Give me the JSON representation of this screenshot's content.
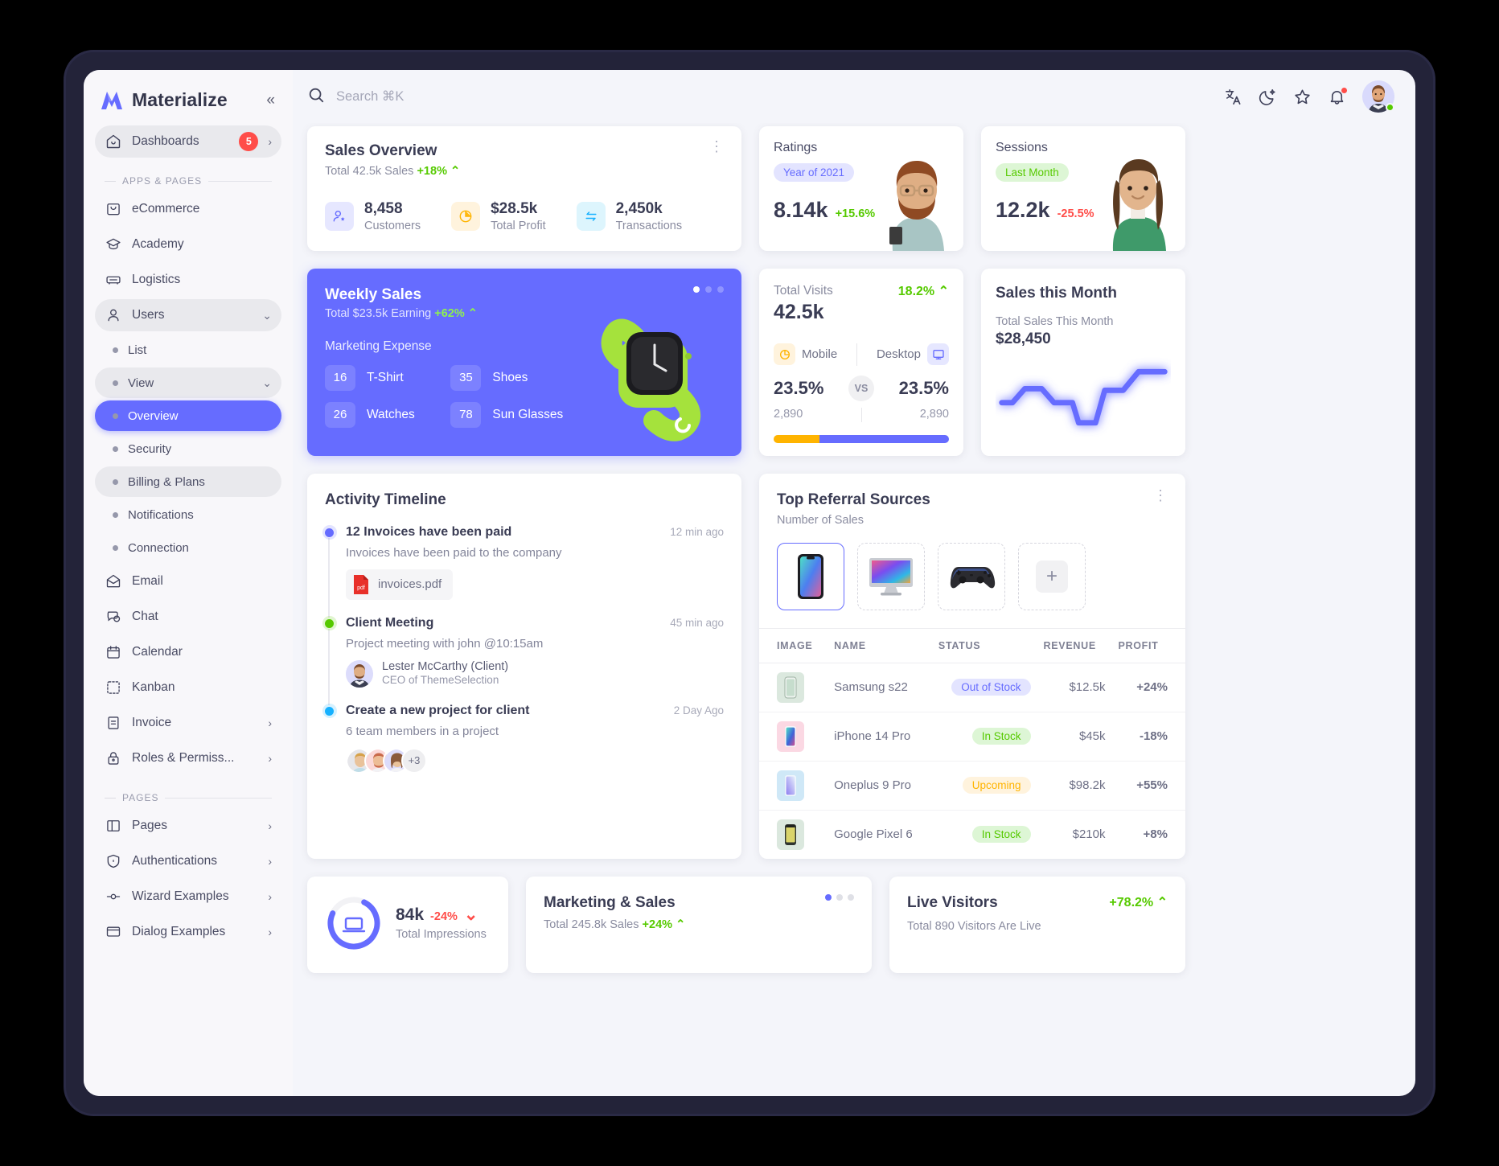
{
  "brand": {
    "name": "Materialize",
    "collapse_icon": "chevrons-left-icon"
  },
  "sidebar": {
    "dashboards": {
      "label": "Dashboards",
      "badge": "5"
    },
    "section_apps": "APPS & PAGES",
    "section_pages": "PAGES",
    "apps_items": [
      {
        "label": "eCommerce",
        "icon": "shopping-bag-icon"
      },
      {
        "label": "Academy",
        "icon": "graduation-cap-icon"
      },
      {
        "label": "Logistics",
        "icon": "car-icon"
      },
      {
        "label": "Users",
        "icon": "user-icon"
      }
    ],
    "users_children": [
      {
        "label": "List"
      },
      {
        "label": "View"
      }
    ],
    "view_children": [
      {
        "label": "Overview"
      },
      {
        "label": "Security"
      },
      {
        "label": "Billing & Plans"
      },
      {
        "label": "Notifications"
      },
      {
        "label": "Connection"
      }
    ],
    "apps_items2": [
      {
        "label": "Email",
        "icon": "mail-icon"
      },
      {
        "label": "Chat",
        "icon": "chat-icon"
      },
      {
        "label": "Calendar",
        "icon": "calendar-icon"
      },
      {
        "label": "Kanban",
        "icon": "kanban-icon"
      },
      {
        "label": "Invoice",
        "icon": "invoice-icon"
      },
      {
        "label": "Roles & Permiss...",
        "icon": "lock-icon"
      }
    ],
    "pages_items": [
      {
        "label": "Pages",
        "icon": "layout-icon"
      },
      {
        "label": "Authentications",
        "icon": "shield-icon"
      },
      {
        "label": "Wizard Examples",
        "icon": "wizard-icon"
      },
      {
        "label": "Dialog Examples",
        "icon": "dialog-icon"
      }
    ]
  },
  "topbar": {
    "search_placeholder": "Search ⌘K",
    "icons": [
      "translate-icon",
      "moon-icon",
      "star-icon",
      "bell-icon"
    ]
  },
  "sales_overview": {
    "title": "Sales Overview",
    "subtitle": "Total 42.5k Sales",
    "delta": "+18%",
    "stats": [
      {
        "value": "8,458",
        "label": "Customers",
        "icon": "customer-icon"
      },
      {
        "value": "$28.5k",
        "label": "Total Profit",
        "icon": "pie-icon"
      },
      {
        "value": "2,450k",
        "label": "Transactions",
        "icon": "transfer-icon"
      }
    ]
  },
  "ratings": {
    "title": "Ratings",
    "pill": "Year of 2021",
    "value": "8.14k",
    "delta": "+15.6%"
  },
  "sessions": {
    "title": "Sessions",
    "pill": "Last Month",
    "value": "12.2k",
    "delta": "-25.5%"
  },
  "weekly_sales": {
    "title": "Weekly Sales",
    "subtitle": "Total $23.5k Earning",
    "delta": "+62%",
    "section": "Marketing Expense",
    "items": [
      {
        "count": "16",
        "label": "T-Shirt"
      },
      {
        "count": "35",
        "label": "Shoes"
      },
      {
        "count": "26",
        "label": "Watches"
      },
      {
        "count": "78",
        "label": "Sun Glasses"
      }
    ]
  },
  "total_visits": {
    "label": "Total Visits",
    "delta": "18.2%",
    "value": "42.5k",
    "left": {
      "name": "Mobile",
      "pct": "23.5%",
      "count": "2,890",
      "icon": "pie-icon"
    },
    "right": {
      "name": "Desktop",
      "pct": "23.5%",
      "count": "2,890",
      "icon": "monitor-icon"
    },
    "vs": "VS",
    "bar_left_pct": 26
  },
  "sales_month": {
    "title": "Sales this Month",
    "subtitle": "Total Sales This Month",
    "value": "$28,450"
  },
  "timeline": {
    "title": "Activity Timeline",
    "items": [
      {
        "title": "12 Invoices have been paid",
        "time": "12 min ago",
        "desc": "Invoices have been paid to the company",
        "color": "#666cff",
        "file": "invoices.pdf"
      },
      {
        "title": "Client Meeting",
        "time": "45 min ago",
        "desc": "Project meeting with john @10:15am",
        "color": "#56ca00",
        "person_name": "Lester McCarthy (Client)",
        "person_role": "CEO of ThemeSelection"
      },
      {
        "title": "Create a new project for client",
        "time": "2 Day Ago",
        "desc": "6 team members in a project",
        "color": "#16b1ff",
        "more": "+3"
      }
    ]
  },
  "referral": {
    "title": "Top Referral Sources",
    "subtitle": "Number of Sales",
    "tiles": [
      "phone-icon",
      "imac-icon",
      "gamepad-icon",
      "add-icon"
    ],
    "columns": [
      "IMAGE",
      "NAME",
      "STATUS",
      "REVENUE",
      "PROFIT"
    ],
    "rows": [
      {
        "name": "Samsung s22",
        "status": "Out of Stock",
        "status_kind": "purple",
        "revenue": "$12.5k",
        "profit": "+24%",
        "profit_up": true,
        "bg": "#dbe8de"
      },
      {
        "name": "iPhone 14 Pro",
        "status": "In Stock",
        "status_kind": "green",
        "revenue": "$45k",
        "profit": "-18%",
        "profit_up": false,
        "bg": "#fbd8e3"
      },
      {
        "name": "Oneplus 9 Pro",
        "status": "Upcoming",
        "status_kind": "amber",
        "revenue": "$98.2k",
        "profit": "+55%",
        "profit_up": true,
        "bg": "#cfe8f7"
      },
      {
        "name": "Google Pixel 6",
        "status": "In Stock",
        "status_kind": "green",
        "revenue": "$210k",
        "profit": "+8%",
        "profit_up": true,
        "bg": "#dbe8de"
      }
    ]
  },
  "impressions": {
    "value": "84k",
    "delta": "-24%",
    "label": "Total Impressions"
  },
  "marketing": {
    "title": "Marketing & Sales",
    "subtitle": "Total 245.8k Sales",
    "delta": "+24%"
  },
  "live_visitors": {
    "title": "Live Visitors",
    "delta": "+78.2%",
    "subtitle": "Total 890 Visitors Are Live"
  }
}
